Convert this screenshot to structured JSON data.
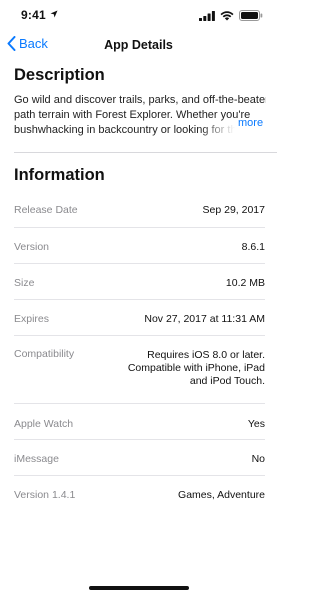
{
  "status_bar": {
    "time": "9:41",
    "icons": [
      "location-arrow-icon",
      "signal-icon",
      "wifi-icon",
      "battery-icon"
    ]
  },
  "nav": {
    "back_label": "Back",
    "title": "App Details"
  },
  "description": {
    "heading": "Description",
    "lines": [
      "Go wild and discover trails, parks, and off-the-beaten-",
      "path terrain with Forest Explorer. Whether you're",
      "bushwhacking in backcountry or looking for the"
    ],
    "more_label": "more"
  },
  "information": {
    "heading": "Information",
    "rows": [
      {
        "label": "Release Date",
        "value": "Sep 29, 2017"
      },
      {
        "label": "Version",
        "value": "8.6.1"
      },
      {
        "label": "Size",
        "value": "10.2 MB"
      },
      {
        "label": "Expires",
        "value": "Nov 27, 2017 at 11:31 AM"
      },
      {
        "label": "Compatibility",
        "value_lines": [
          "Requires iOS 8.0 or later.",
          "Compatible with iPhone, iPad",
          "and iPod Touch."
        ]
      },
      {
        "label": "Apple Watch",
        "value": "Yes"
      },
      {
        "label": "iMessage",
        "value": "No"
      },
      {
        "label": "Version 1.4.1",
        "value": "Games, Adventure"
      }
    ]
  },
  "colors": {
    "accent": "#0a7aff",
    "label_gray": "#8a8a8e",
    "divider": "#e4e4e8"
  }
}
